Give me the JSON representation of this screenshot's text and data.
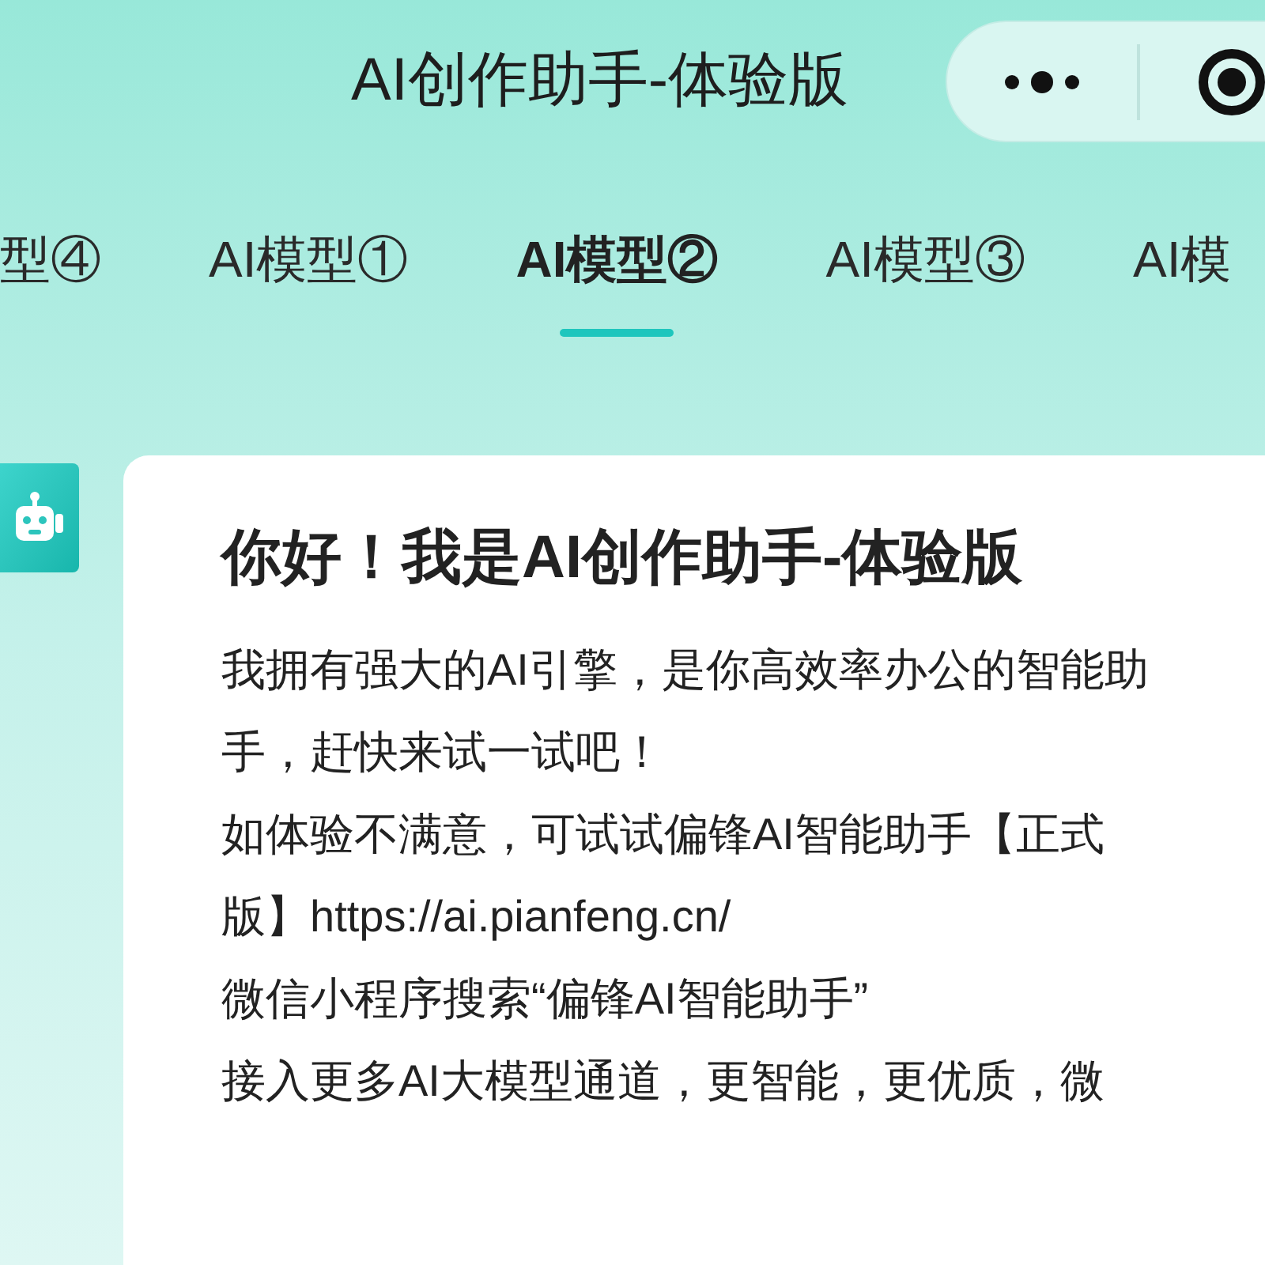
{
  "nav_bar": {
    "title": "AI创作助手-体验版"
  },
  "tabs": [
    {
      "label": "型④",
      "selected": false
    },
    {
      "label": "AI模型①",
      "selected": false
    },
    {
      "label": "AI模型②",
      "selected": true
    },
    {
      "label": "AI模型③",
      "selected": false
    },
    {
      "label": "AI模",
      "selected": false
    }
  ],
  "message": {
    "title": "你好！我是AI创作助手-体验版",
    "paragraphs": [
      "我拥有强大的AI引擎，是你高效率办公的智能助手，赶快来试一试吧！",
      "如体验不满意，可试试偏锋AI智能助手【正式版】https://ai.pianfeng.cn/",
      "微信小程序搜索“偏锋AI智能助手”",
      "接入更多AI大模型通道，更智能，更优质，微"
    ]
  }
}
